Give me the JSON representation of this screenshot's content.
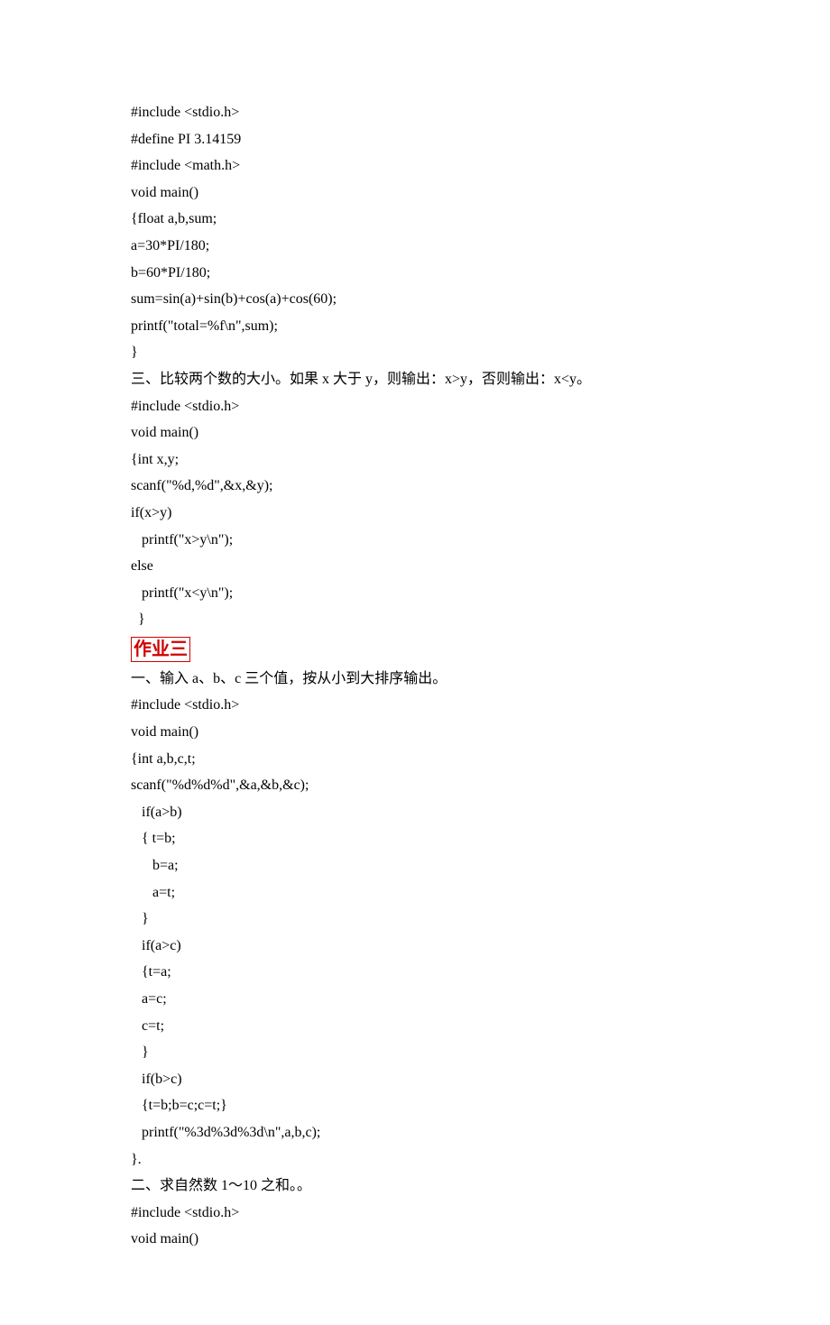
{
  "lines": [
    "#include <stdio.h>",
    "#define PI 3.14159",
    "#include <math.h>",
    "void main()",
    "{float a,b,sum;",
    "a=30*PI/180;",
    "b=60*PI/180;",
    "sum=sin(a)+sin(b)+cos(a)+cos(60);",
    "printf(\"total=%f\\n\",sum);",
    "}",
    "三、比较两个数的大小。如果 x 大于 y，则输出：x>y，否则输出：x<y。",
    "#include <stdio.h>",
    "void main()",
    "{int x,y;",
    "scanf(\"%d,%d\",&x,&y);",
    "if(x>y)",
    "   printf(\"x>y\\n\");",
    "else",
    "   printf(\"x<y\\n\");",
    "  }"
  ],
  "heading": "作业三",
  "lines2": [
    "一、输入 a、b、c 三个值，按从小到大排序输出。",
    "#include <stdio.h>",
    "void main()",
    "{int a,b,c,t;",
    "scanf(\"%d%d%d\",&a,&b,&c);",
    "   if(a>b)",
    "   { t=b;",
    "      b=a;",
    "      a=t;",
    "   }",
    "   if(a>c)",
    "   {t=a;",
    "   a=c;",
    "   c=t;",
    "   }",
    "   if(b>c)",
    "   {t=b;b=c;c=t;}",
    "   printf(\"%3d%3d%3d\\n\",a,b,c);",
    "}.",
    "二、求自然数 1～10 之和。。",
    "#include <stdio.h>",
    "void main()"
  ]
}
